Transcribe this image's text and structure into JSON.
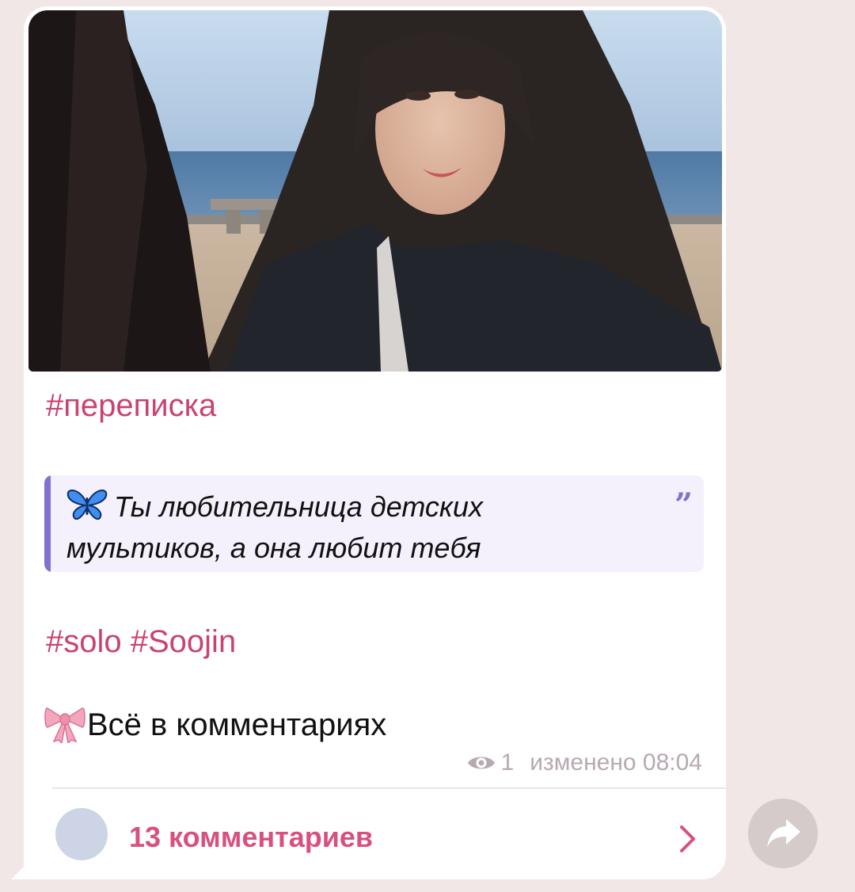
{
  "post": {
    "hashtag_top": "#переписка",
    "quote": {
      "emoji": "butterfly-emoji",
      "text": "Ты любительница детских мультиков, а она любит тебя",
      "quote_mark": "”"
    },
    "hashtags_bottom": [
      "#solo",
      "#Soojin"
    ],
    "cta": {
      "emoji": "ribbon-emoji",
      "text": "Всё в комментариях"
    },
    "meta": {
      "views_icon": "eye-icon",
      "views": "1",
      "edited_label": "изменено",
      "time": "08:04"
    }
  },
  "comments": {
    "label": "13 комментариев",
    "chevron_icon": "chevron-right-icon"
  },
  "share_button": {
    "icon": "share-arrow-icon"
  },
  "colors": {
    "background": "#f1e7e7",
    "bubble": "#ffffff",
    "hashtag": "#c9436f",
    "quote_accent": "#8470cf",
    "quote_bg": "#f4f0fc",
    "comments_accent": "#d8507d",
    "meta": "#b7a9b2"
  }
}
